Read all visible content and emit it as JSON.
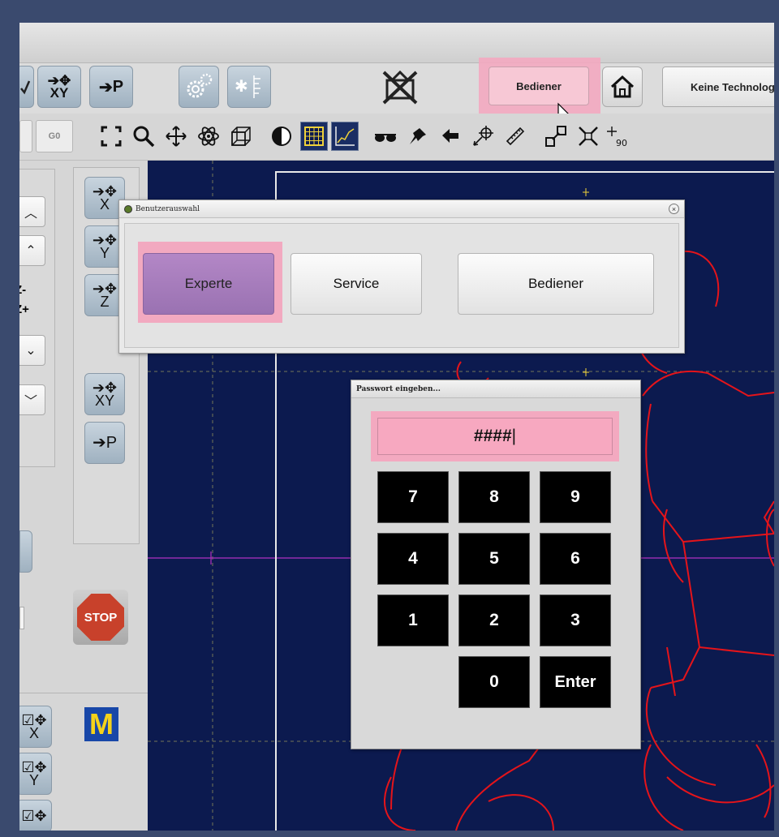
{
  "toolbar": {
    "bediener_label": "Bediener",
    "technology_label": "Keine Technologie",
    "g0_label": "G0",
    "xy_label": "XY",
    "p_label": "P"
  },
  "left_panel": {
    "axes": [
      "X",
      "Y",
      "Z"
    ],
    "xy_label": "XY",
    "p_label": "P",
    "z_minus": "Z-",
    "z_plus": "Z+",
    "stop_label": "STOP",
    "m_label": "M"
  },
  "user_dialog": {
    "title": "Benutzerauswahl",
    "close": "×",
    "buttons": [
      "Experte",
      "Service",
      "Bediener"
    ]
  },
  "password_dialog": {
    "title": "Passwort eingeben...",
    "value": "####",
    "keys": [
      "7",
      "8",
      "9",
      "4",
      "5",
      "6",
      "1",
      "2",
      "3",
      "0",
      "Enter"
    ]
  },
  "colors": {
    "highlight": "#f3a9c0",
    "canvas_bg": "#0c1a4f",
    "drawing": "#e5141a",
    "selected_button": "#a67dbd"
  }
}
